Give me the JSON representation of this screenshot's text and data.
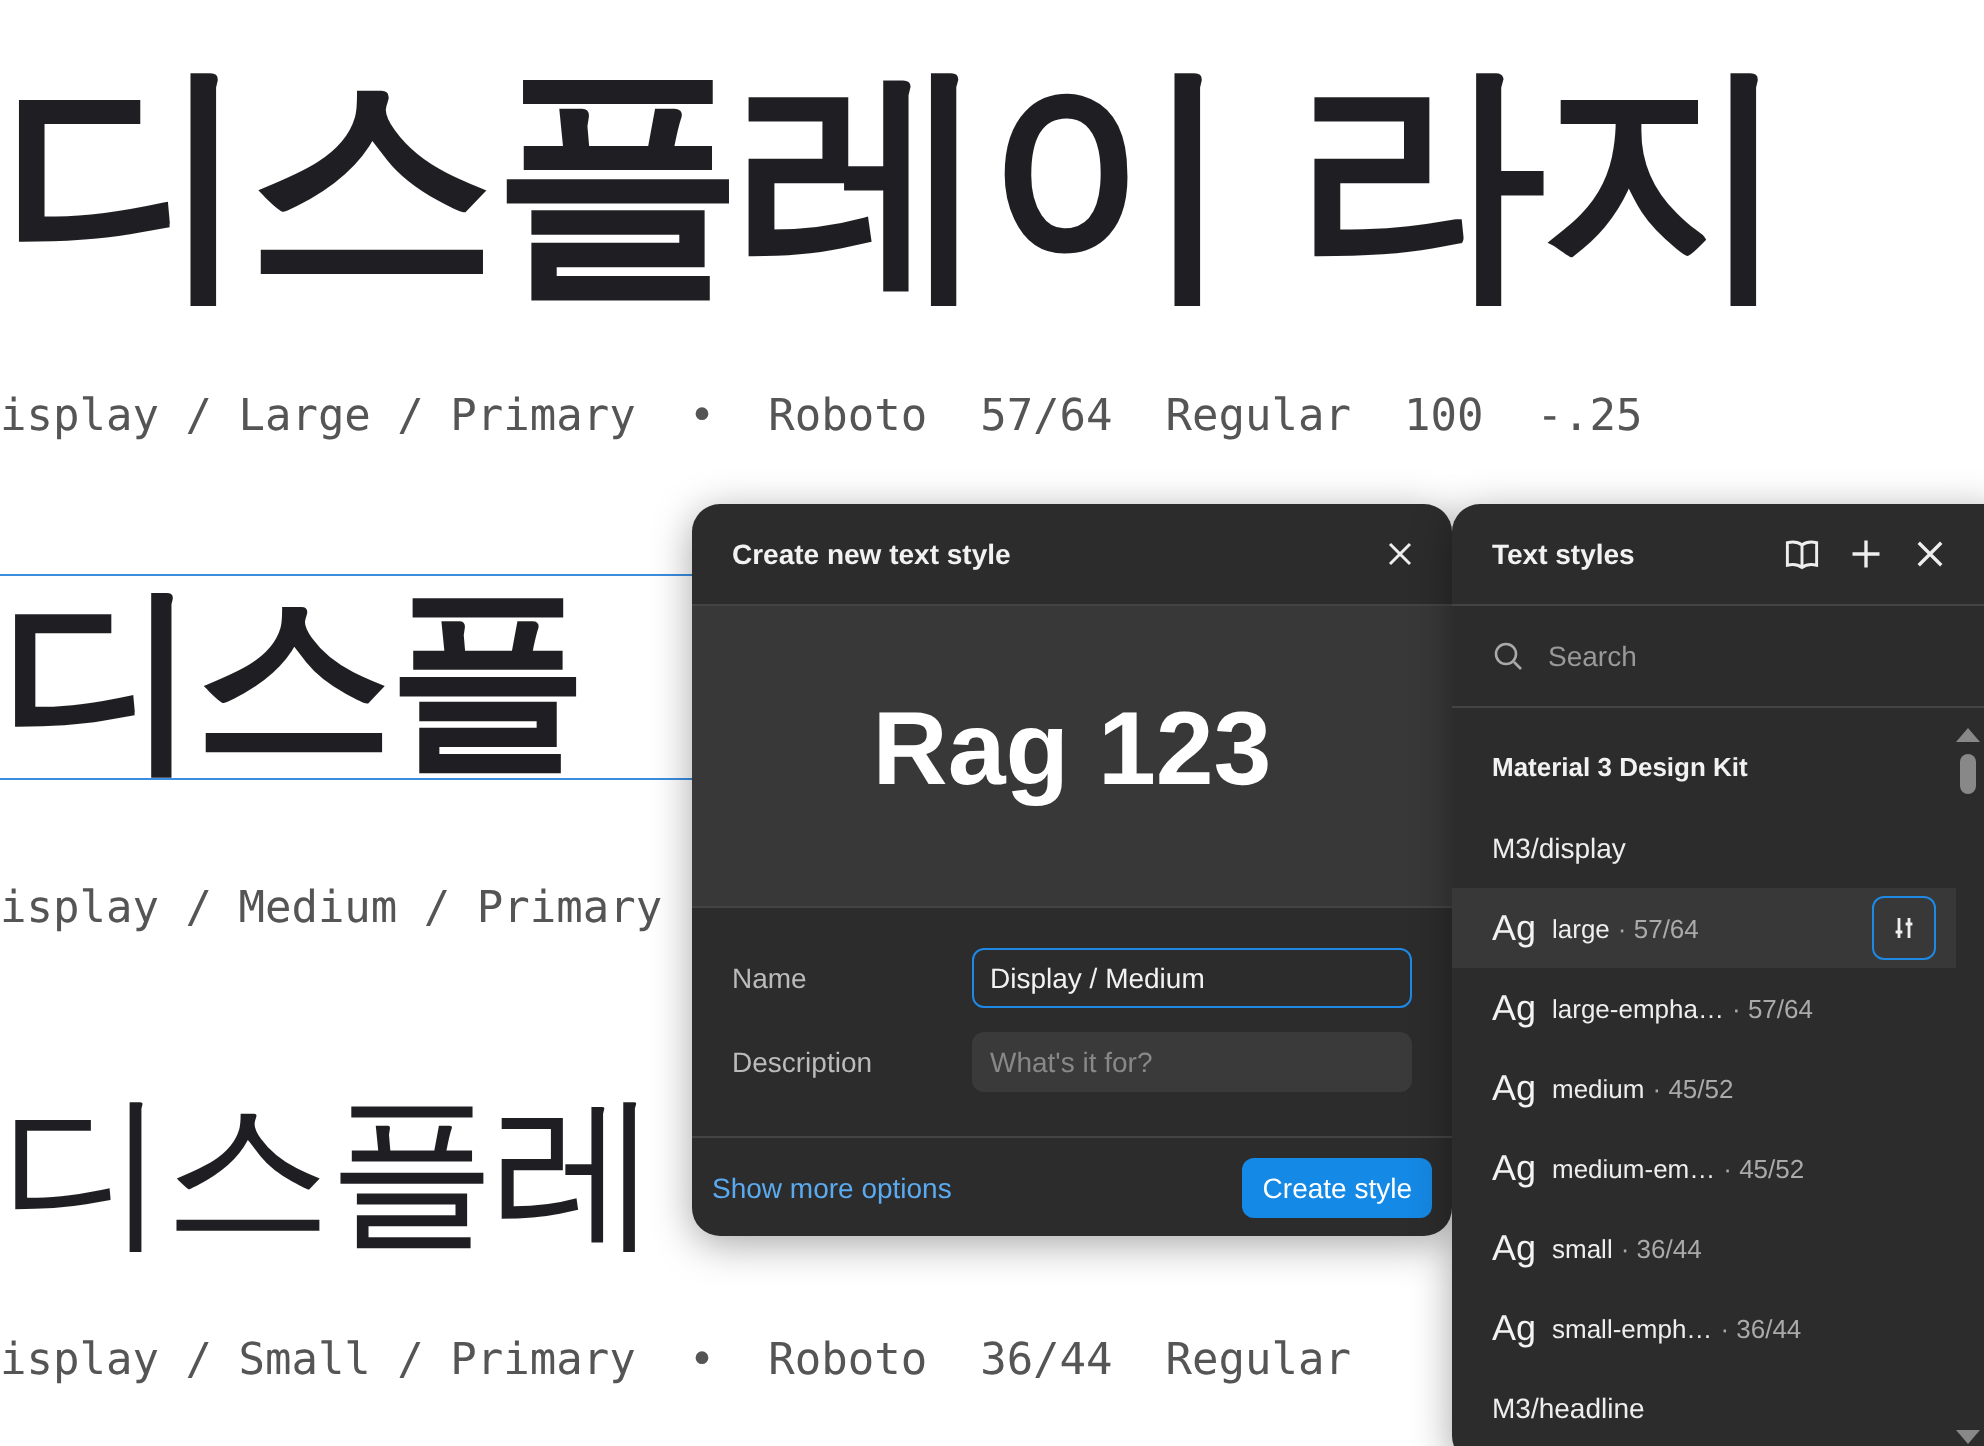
{
  "canvas": {
    "specimens": [
      {
        "sample": "디스플레이 라지",
        "caption": "isplay / Large / Primary  •  Roboto  57/64  Regular  100  -.25",
        "selected": false
      },
      {
        "sample": "디스플",
        "caption": "isplay / Medium / Primary",
        "selected": true
      },
      {
        "sample": "디스플레",
        "caption": "isplay / Small / Primary  •  Roboto  36/44  Regular",
        "selected": false
      }
    ]
  },
  "create_dialog": {
    "title": "Create new text style",
    "preview": "Rag 123",
    "fields": [
      {
        "label": "Name",
        "value": "Display / Medium",
        "focused": true
      },
      {
        "label": "Description",
        "placeholder": "What's it for?",
        "focused": false
      }
    ],
    "link": "Show more options",
    "button": "Create style"
  },
  "styles_panel": {
    "title": "Text styles",
    "search": {
      "placeholder": "Search"
    },
    "items": [
      {
        "kind": "library",
        "label": "Material 3 Design Kit"
      },
      {
        "kind": "group",
        "label": "M3/display"
      },
      {
        "kind": "style",
        "preview": "Ag",
        "label": "large",
        "spec": "· 57/64",
        "selected": true
      },
      {
        "kind": "style",
        "preview": "Ag",
        "label": "large-empha…",
        "spec": "· 57/64",
        "selected": false
      },
      {
        "kind": "style",
        "preview": "Ag",
        "label": "medium",
        "spec": "· 45/52",
        "selected": false
      },
      {
        "kind": "style",
        "preview": "Ag",
        "label": "medium-em…",
        "spec": "· 45/52",
        "selected": false
      },
      {
        "kind": "style",
        "preview": "Ag",
        "label": "small",
        "spec": "· 36/44",
        "selected": false
      },
      {
        "kind": "style",
        "preview": "Ag",
        "label": "small-emph…",
        "spec": "· 36/44",
        "selected": false
      },
      {
        "kind": "group",
        "label": "M3/headline"
      }
    ]
  }
}
